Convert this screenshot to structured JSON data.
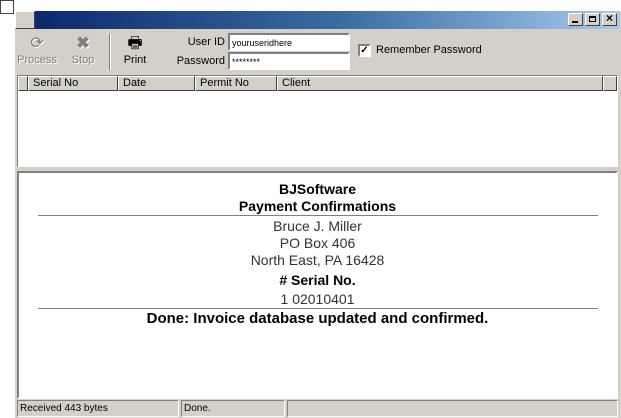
{
  "window": {
    "title": "",
    "caption_buttons": [
      "minimize",
      "maximize",
      "close"
    ]
  },
  "toolbar": {
    "process_label": "Process",
    "stop_label": "Stop",
    "print_label": "Print",
    "user_id_label": "User ID",
    "user_id_value": "youruseridhere",
    "password_label": "Password",
    "password_value": "********",
    "remember_label": "Remember Password",
    "remember_checked": true
  },
  "list": {
    "columns": [
      "",
      "Serial No",
      "Date",
      "Permit No",
      "Client"
    ],
    "rows": []
  },
  "document": {
    "company": "BJSoftware",
    "heading": "Payment Confirmations",
    "address": [
      "Bruce J. Miller",
      "PO Box 406",
      "North East, PA 16428"
    ],
    "serial_heading": "# Serial No.",
    "serial_value": "1 02010401",
    "status_message": "Done: Invoice database updated and confirmed."
  },
  "statusbar": {
    "panels": [
      "Received 443 bytes",
      "Done.",
      ""
    ]
  }
}
